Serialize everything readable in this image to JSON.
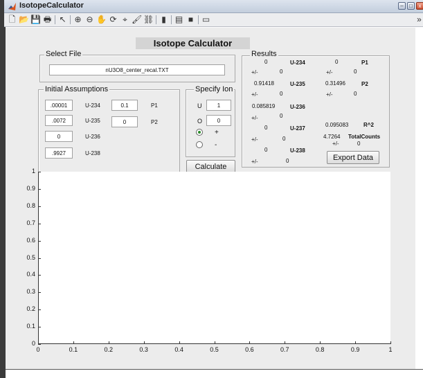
{
  "window": {
    "title": "IsotopeCalculator",
    "min": "–",
    "max": "□",
    "close": "x"
  },
  "toolbar": {
    "icons": [
      "new-file-icon",
      "open-folder-icon",
      "save-icon",
      "print-icon",
      "pointer-arrow-icon",
      "zoom-in-icon",
      "zoom-out-icon",
      "pan-hand-icon",
      "rotate-3d-icon",
      "data-cursor-icon",
      "brush-icon",
      "link-plot-icon",
      "colorbar-icon",
      "legend-icon",
      "hide-plot-tools-icon",
      "show-plot-tools-icon"
    ],
    "glyphs": [
      "🗋",
      "📂",
      "💾",
      "🖶",
      "↖",
      "⊕",
      "⊖",
      "✋",
      "⟳",
      "⌖",
      "🖌",
      "⛓",
      "▮",
      "▤",
      "■",
      "▭"
    ],
    "overflow": "»"
  },
  "main": {
    "title": "Isotope Calculator"
  },
  "select_file": {
    "title": "Select File",
    "filename": "nU3O8_center_recal.TXT"
  },
  "initial": {
    "title": "Initial Assumptions",
    "u234_value": ".00001",
    "u234_label": "U-234",
    "u235_value": ".0072",
    "u235_label": "U-235",
    "u236_value": "0",
    "u236_label": "U-236",
    "u238_value": ".9927",
    "u238_label": "U-238",
    "p1_value": "0.1",
    "p1_label": "P1",
    "p2_value": "0",
    "p2_label": "P2"
  },
  "ion": {
    "title": "Specify Ion",
    "u_label": "U",
    "u_value": "1",
    "o_label": "O",
    "o_value": "0",
    "plus_label": "+",
    "minus_label": "-",
    "selected": "+"
  },
  "calculate_label": "Calculate",
  "results": {
    "title": "Results",
    "pm": "+/-",
    "u234": {
      "label": "U-234",
      "value": "0",
      "err": "0"
    },
    "u235": {
      "label": "U-235",
      "value": "0.91418",
      "err": "0"
    },
    "u236": {
      "label": "U-236",
      "value": "0.085819",
      "err": "0"
    },
    "u237": {
      "label": "U-237",
      "value": "0",
      "err": "0"
    },
    "u238": {
      "label": "U-238",
      "value": "0",
      "err": "0"
    },
    "p1": {
      "label": "P1",
      "value": "0",
      "err": "0"
    },
    "p2": {
      "label": "P2",
      "value": "0.31496",
      "err": "0"
    },
    "r2": {
      "label": "R^2",
      "value": "0.095083"
    },
    "total": {
      "label": "TotalCounts",
      "value": "4.7264",
      "err": "0"
    },
    "export_label": "Export Data"
  },
  "chart_data": {
    "type": "line",
    "series": [],
    "xlim": [
      0,
      1
    ],
    "ylim": [
      0,
      1
    ],
    "xticks": [
      "0",
      "0.1",
      "0.2",
      "0.3",
      "0.4",
      "0.5",
      "0.6",
      "0.7",
      "0.8",
      "0.9",
      "1"
    ],
    "yticks": [
      "0",
      "0.1",
      "0.2",
      "0.3",
      "0.4",
      "0.5",
      "0.6",
      "0.7",
      "0.8",
      "0.9",
      "1"
    ],
    "grid": false
  }
}
